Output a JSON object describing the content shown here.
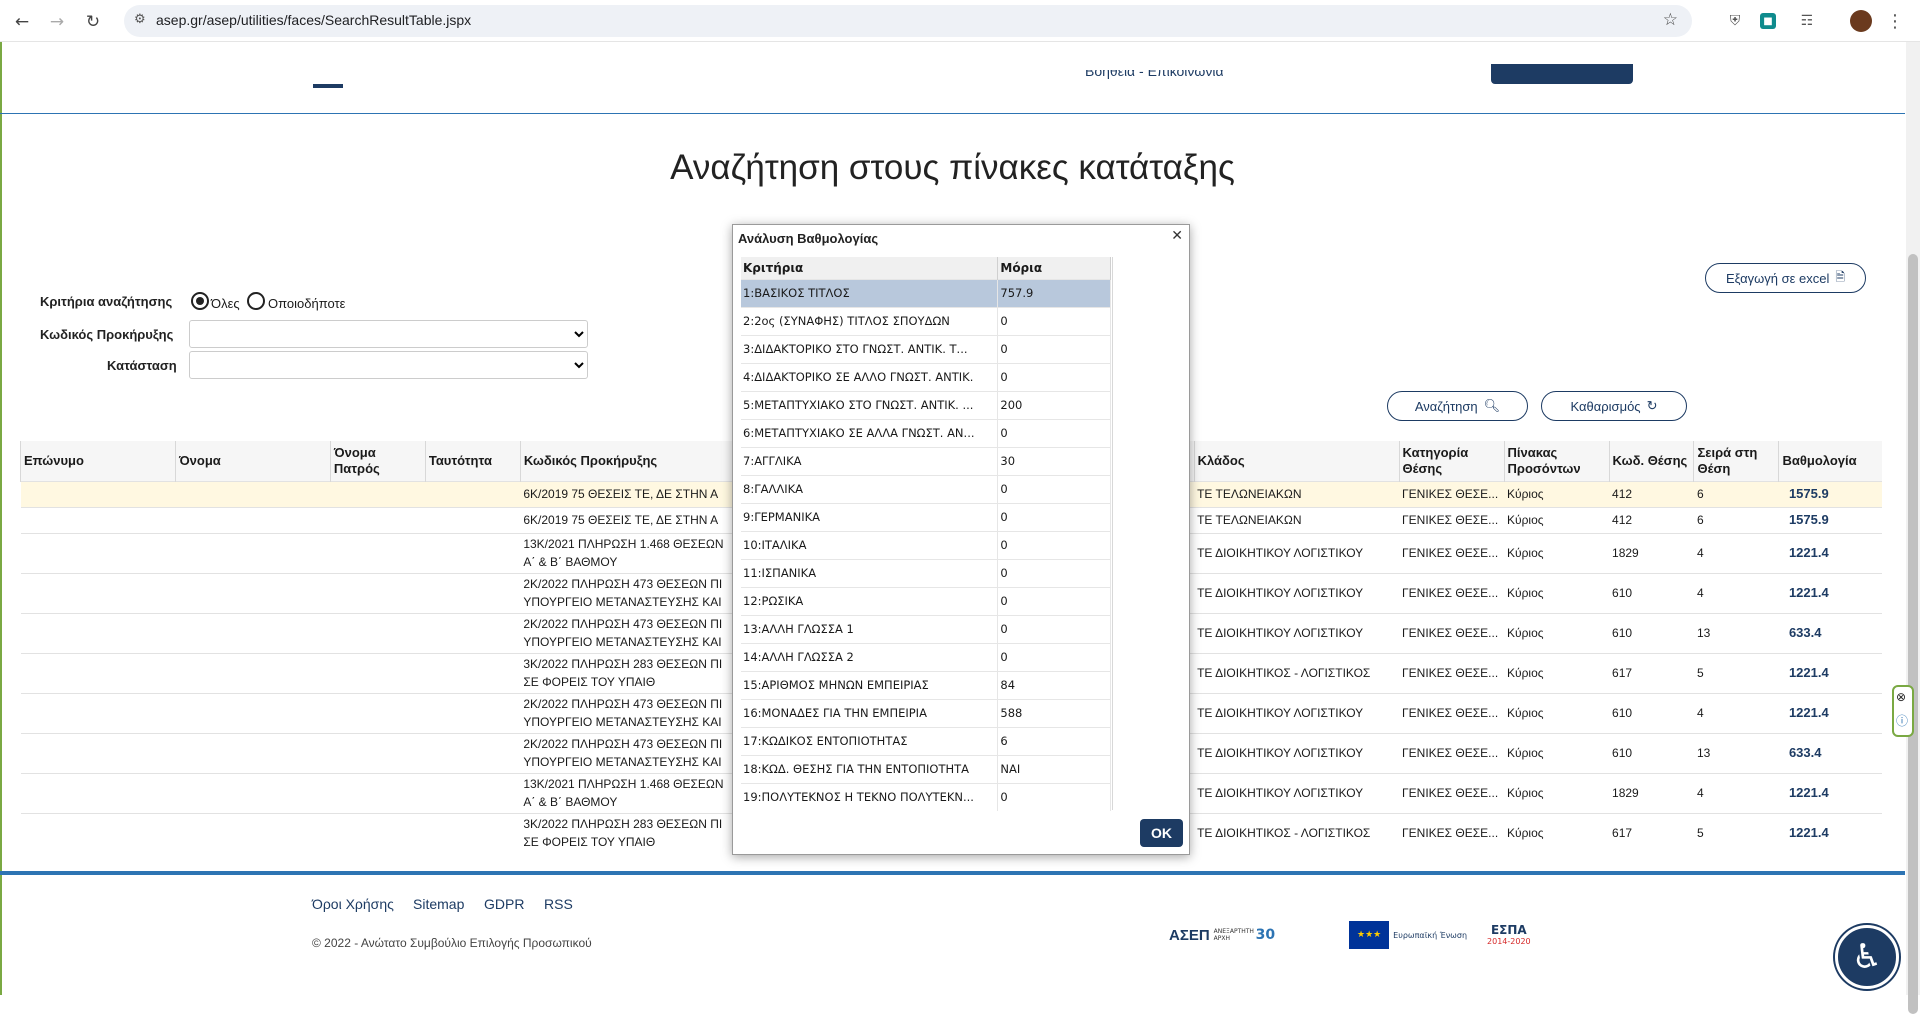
{
  "browser": {
    "url": "asep.gr/asep/utilities/faces/SearchResultTable.jspx"
  },
  "topnav": {
    "help_contact": "Βοήθεια - Επικοινωνία"
  },
  "page_title": "Αναζήτηση στους πίνακες κατάταξης",
  "export_label": "Εξαγωγή σε excel",
  "criteria": {
    "label": "Κριτήρια αναζήτησης",
    "option_all": "Όλες",
    "option_any": "Οποιοδήποτε"
  },
  "fields": {
    "code_label": "Κωδικός Προκήρυξης",
    "status_label": "Κατάσταση"
  },
  "buttons": {
    "search": "Αναζήτηση",
    "clear": "Καθαρισμός"
  },
  "table": {
    "headers": [
      "Επώνυμο",
      "Όνομα",
      "Όνομα Πατρός",
      "Ταυτότητα",
      "Κωδικός Προκήρυξης",
      "Κλάδος",
      "Κατηγορία Θέσης",
      "Πίνακας Προσόντων",
      "Κωδ. Θέσης",
      "Σειρά στη Θέση",
      "Βαθμολογία"
    ],
    "rows": [
      {
        "code1": "6Κ/2019 75 ΘΕΣΕΙΣ ΤΕ, ΔΕ ΣΤΗΝ Α",
        "code2": "",
        "branch": "ΤΕ ΤΕΛΩΝΕΙΑΚΩΝ",
        "category": "ΓΕΝΙΚΕΣ ΘΕΣΕ...",
        "table": "Κύριος",
        "pos": "412",
        "rank": "6",
        "score": "1575.9"
      },
      {
        "code1": "6Κ/2019 75 ΘΕΣΕΙΣ ΤΕ, ΔΕ ΣΤΗΝ Α",
        "code2": "",
        "branch": "ΤΕ ΤΕΛΩΝΕΙΑΚΩΝ",
        "category": "ΓΕΝΙΚΕΣ ΘΕΣΕ...",
        "table": "Κύριος",
        "pos": "412",
        "rank": "6",
        "score": "1575.9"
      },
      {
        "code1": "13Κ/2021 ΠΛΗΡΩΣΗ 1.468 ΘΕΣΕΩΝ",
        "code2": "Α΄ & Β΄ ΒΑΘΜΟΥ",
        "branch": "ΤΕ ΔΙΟΙΚΗΤΙΚΟΥ ΛΟΓΙΣΤΙΚΟΥ",
        "category": "ΓΕΝΙΚΕΣ ΘΕΣΕ...",
        "table": "Κύριος",
        "pos": "1829",
        "rank": "4",
        "score": "1221.4"
      },
      {
        "code1": "2Κ/2022 ΠΛΗΡΩΣΗ 473 ΘΕΣΕΩΝ ΠΙ",
        "code2": "ΥΠΟΥΡΓΕΙΟ ΜΕΤΑΝΑΣΤΕΥΣΗΣ ΚΑΙ",
        "branch": "ΤΕ ΔΙΟΙΚΗΤΙΚΟΥ ΛΟΓΙΣΤΙΚΟΥ",
        "category": "ΓΕΝΙΚΕΣ ΘΕΣΕ...",
        "table": "Κύριος",
        "pos": "610",
        "rank": "4",
        "score": "1221.4"
      },
      {
        "code1": "2Κ/2022 ΠΛΗΡΩΣΗ 473 ΘΕΣΕΩΝ ΠΙ",
        "code2": "ΥΠΟΥΡΓΕΙΟ ΜΕΤΑΝΑΣΤΕΥΣΗΣ ΚΑΙ",
        "branch": "ΤΕ ΔΙΟΙΚΗΤΙΚΟΥ ΛΟΓΙΣΤΙΚΟΥ",
        "category": "ΓΕΝΙΚΕΣ ΘΕΣΕ...",
        "table": "Κύριος",
        "pos": "610",
        "rank": "13",
        "score": "633.4"
      },
      {
        "code1": "3Κ/2022 ΠΛΗΡΩΣΗ 283 ΘΕΣΕΩΝ ΠΙ",
        "code2": "ΣΕ ΦΟΡΕΙΣ ΤΟΥ ΥΠΑΙΘ",
        "branch": "ΤΕ ΔΙΟΙΚΗΤΙΚΟΣ - ΛΟΓΙΣΤΙΚΟΣ",
        "category": "ΓΕΝΙΚΕΣ ΘΕΣΕ...",
        "table": "Κύριος",
        "pos": "617",
        "rank": "5",
        "score": "1221.4"
      },
      {
        "code1": "2Κ/2022 ΠΛΗΡΩΣΗ 473 ΘΕΣΕΩΝ ΠΙ",
        "code2": "ΥΠΟΥΡΓΕΙΟ ΜΕΤΑΝΑΣΤΕΥΣΗΣ ΚΑΙ",
        "branch": "ΤΕ ΔΙΟΙΚΗΤΙΚΟΥ ΛΟΓΙΣΤΙΚΟΥ",
        "category": "ΓΕΝΙΚΕΣ ΘΕΣΕ...",
        "table": "Κύριος",
        "pos": "610",
        "rank": "4",
        "score": "1221.4"
      },
      {
        "code1": "2Κ/2022 ΠΛΗΡΩΣΗ 473 ΘΕΣΕΩΝ ΠΙ",
        "code2": "ΥΠΟΥΡΓΕΙΟ ΜΕΤΑΝΑΣΤΕΥΣΗΣ ΚΑΙ",
        "branch": "ΤΕ ΔΙΟΙΚΗΤΙΚΟΥ ΛΟΓΙΣΤΙΚΟΥ",
        "category": "ΓΕΝΙΚΕΣ ΘΕΣΕ...",
        "table": "Κύριος",
        "pos": "610",
        "rank": "13",
        "score": "633.4"
      },
      {
        "code1": "13Κ/2021 ΠΛΗΡΩΣΗ 1.468 ΘΕΣΕΩΝ",
        "code2": "Α΄ & Β΄ ΒΑΘΜΟΥ",
        "branch": "ΤΕ ΔΙΟΙΚΗΤΙΚΟΥ ΛΟΓΙΣΤΙΚΟΥ",
        "category": "ΓΕΝΙΚΕΣ ΘΕΣΕ...",
        "table": "Κύριος",
        "pos": "1829",
        "rank": "4",
        "score": "1221.4"
      },
      {
        "code1": "3Κ/2022 ΠΛΗΡΩΣΗ 283 ΘΕΣΕΩΝ ΠΙ",
        "code2": "ΣΕ ΦΟΡΕΙΣ ΤΟΥ ΥΠΑΙΘ",
        "branch": "ΤΕ ΔΙΟΙΚΗΤΙΚΟΣ - ΛΟΓΙΣΤΙΚΟΣ",
        "category": "ΓΕΝΙΚΕΣ ΘΕΣΕ...",
        "table": "Κύριος",
        "pos": "617",
        "rank": "5",
        "score": "1221.4"
      }
    ]
  },
  "modal": {
    "title": "Ανάλυση Βαθμολογίας",
    "col_criteria": "Κριτήρια",
    "col_points": "Μόρια",
    "ok_label": "OK",
    "rows": [
      {
        "c": "1:ΒΑΣΙΚΟΣ ΤΙΤΛΟΣ",
        "p": "757.9"
      },
      {
        "c": "2:2ος (ΣΥΝΑΦΗΣ) ΤΙΤΛΟΣ ΣΠΟΥΔΩΝ",
        "p": "0"
      },
      {
        "c": "3:ΔΙΔΑΚΤΟΡΙΚΟ ΣΤΟ ΓΝΩΣΤ. ΑΝΤΙΚ. Τ...",
        "p": "0"
      },
      {
        "c": "4:ΔΙΔΑΚΤΟΡΙΚΟ ΣΕ ΑΛΛΟ ΓΝΩΣΤ. ΑΝΤΙΚ.",
        "p": "0"
      },
      {
        "c": "5:ΜΕΤΑΠΤΥΧΙΑΚΟ ΣΤΟ ΓΝΩΣΤ. ΑΝΤΙΚ. ...",
        "p": "200"
      },
      {
        "c": "6:ΜΕΤΑΠΤΥΧΙΑΚΟ ΣΕ ΑΛΛΑ ΓΝΩΣΤ. ΑΝ...",
        "p": "0"
      },
      {
        "c": "7:ΑΓΓΛΙΚΑ",
        "p": "30"
      },
      {
        "c": "8:ΓΑΛΛΙΚΑ",
        "p": "0"
      },
      {
        "c": "9:ΓΕΡΜΑΝΙΚΑ",
        "p": "0"
      },
      {
        "c": "10:ΙΤΑΛΙΚΑ",
        "p": "0"
      },
      {
        "c": "11:ΙΣΠΑΝΙΚΑ",
        "p": "0"
      },
      {
        "c": "12:ΡΩΣΙΚΑ",
        "p": "0"
      },
      {
        "c": "13:ΑΛΛΗ ΓΛΩΣΣΑ 1",
        "p": "0"
      },
      {
        "c": "14:ΑΛΛΗ ΓΛΩΣΣΑ 2",
        "p": "0"
      },
      {
        "c": "15:ΑΡΙΘΜΟΣ ΜΗΝΩΝ ΕΜΠΕΙΡΙΑΣ",
        "p": "84"
      },
      {
        "c": "16:ΜΟΝΑΔΕΣ ΓΙΑ ΤΗΝ ΕΜΠΕΙΡΙΑ",
        "p": "588"
      },
      {
        "c": "17:ΚΩΔΙΚΟΣ ΕΝΤΟΠΙΟΤΗΤΑΣ",
        "p": "6"
      },
      {
        "c": "18:ΚΩΔ. ΘΕΣΗΣ ΓΙΑ ΤΗΝ ΕΝΤΟΠΙΟΤΗΤΑ",
        "p": "ΝΑΙ"
      },
      {
        "c": "19:ΠΟΛΥΤΕΚΝΟΣ Η ΤΕΚΝΟ ΠΟΛΥΤΕΚΝ...",
        "p": "0"
      }
    ]
  },
  "footer": {
    "links": [
      "Όροι Χρήσης",
      "Sitemap",
      "GDPR",
      "RSS"
    ],
    "copyright": "© 2022 - Ανώτατο Συμβούλιο Επιλογής Προσωπικού",
    "logo_asep": "ΑΣΕΠ",
    "logo_asep_sub": "ΑΝΕΞΑΡΤΗΤΗ ΑΡΧΗ",
    "logo_eu": "Ευρωπαϊκή Ένωση",
    "logo_espa": "ΕΣΠΑ",
    "logo_espa_years": "2014-2020"
  },
  "colors": {
    "brand_navy": "#1d3b63",
    "brand_blue": "#2d74b3",
    "row_highlight": "#fff8e1",
    "modal_selected": "#b8c8dc"
  }
}
